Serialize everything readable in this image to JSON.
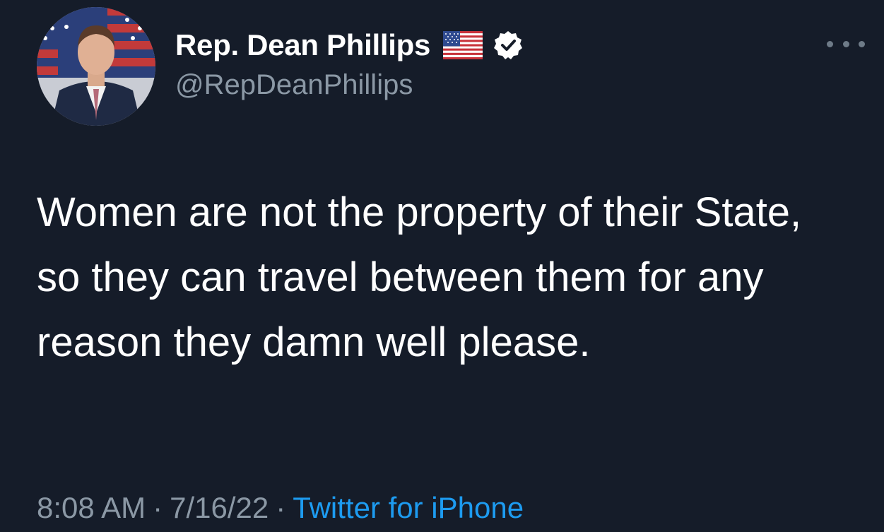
{
  "author": {
    "display_name": "Rep. Dean Phillips",
    "handle": "@RepDeanPhillips",
    "badges": [
      "us-flag-icon",
      "verified-icon"
    ]
  },
  "tweet": {
    "text": "Women are not the property of their State, so they can travel between them for any reason they damn well please."
  },
  "meta": {
    "time": "8:08 AM",
    "date": "7/16/22",
    "separator": "·",
    "source": "Twitter for iPhone"
  },
  "colors": {
    "background": "#151c29",
    "text": "#ffffff",
    "secondary": "#8b98a5",
    "link": "#1d9bf0"
  }
}
